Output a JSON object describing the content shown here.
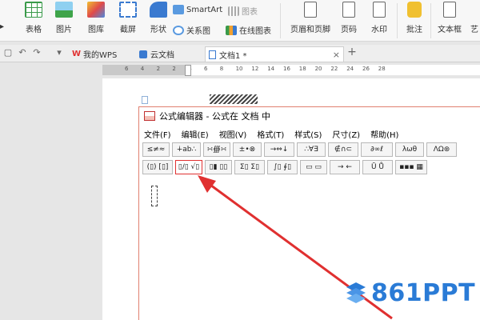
{
  "ribbon": {
    "left_cut": "▸",
    "table": "表格",
    "picture": "图片",
    "gallery": "图库",
    "screenshot": "截屏",
    "shape": "形状",
    "smartart": "SmartArt",
    "chart": "图表",
    "relation": "关系图",
    "online_chart": "在线图表",
    "header_footer": "页眉和页脚",
    "page_number": "页码",
    "watermark": "水印",
    "comment": "批注",
    "textbox": "文本框",
    "art": "艺"
  },
  "tabs": {
    "wps": "我的WPS",
    "cloud": "云文档",
    "doc1": "文档1 *",
    "close": "×",
    "add": "+"
  },
  "ruler": [
    "6",
    "4",
    "2",
    "2",
    "4",
    "6",
    "8",
    "10",
    "12",
    "14",
    "16",
    "18",
    "20",
    "22",
    "24",
    "26",
    "28"
  ],
  "editor": {
    "title": "公式编辑器 - 公式在 文档 中",
    "menu": [
      "文件(F)",
      "编辑(E)",
      "视图(V)",
      "格式(T)",
      "样式(S)",
      "尺寸(Z)",
      "帮助(H)"
    ],
    "palette_row1": [
      "≤≠≈",
      "∔ab∴",
      "∺∰∺",
      "±•⊗",
      "→⇔↓",
      "∴∀∃",
      "∉∩⊂",
      "∂∞ℓ",
      "λωθ",
      "ΛΩ⊛"
    ],
    "palette_row2": [
      "(▯) [▯]",
      "▯/▯ √▯",
      "▯▮ ▯▯",
      "Σ▯ Σ▯",
      "∫▯ ∮▯",
      "▭ ▭",
      "→ ←",
      "Ū Ů",
      "▪▪▪ ▦"
    ]
  },
  "watermark_text": "861PPT",
  "colors": {
    "accent_red": "#e03030",
    "watermark_blue": "#2a7bd6"
  }
}
